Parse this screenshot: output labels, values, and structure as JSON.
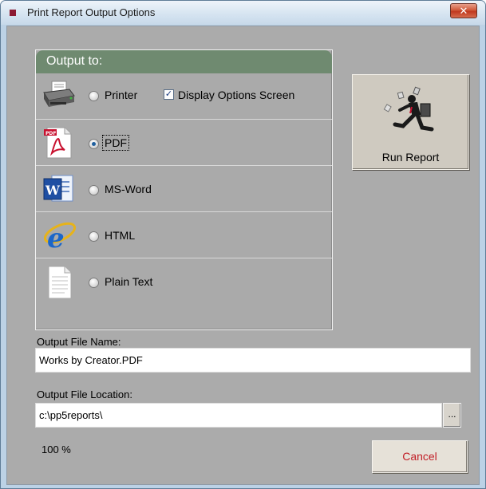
{
  "window": {
    "title": "Print Report Output Options",
    "close_label": "✕",
    "accent": "#8c1a32"
  },
  "output_group": {
    "title": "Output to:",
    "options": [
      {
        "label": "Printer",
        "icon": "printer-icon",
        "selected": false
      },
      {
        "label": "PDF",
        "icon": "pdf-document-icon",
        "selected": true
      },
      {
        "label": "MS-Word",
        "icon": "ms-word-icon",
        "selected": false
      },
      {
        "label": "HTML",
        "icon": "internet-explorer-icon",
        "selected": false
      },
      {
        "label": "Plain Text",
        "icon": "text-document-icon",
        "selected": false
      }
    ],
    "display_options": {
      "label": "Display Options Screen",
      "checked": true
    }
  },
  "run_button": {
    "label": "Run Report",
    "icon": "running-man-icon"
  },
  "file_name": {
    "label": "Output File Name:",
    "value": "Works by Creator.PDF"
  },
  "file_location": {
    "label": "Output File Location:",
    "value": "c:\\pp5reports\\",
    "browse_label": "..."
  },
  "progress": {
    "text": "100 %",
    "value": 100
  },
  "cancel_button": {
    "label": "Cancel",
    "color": "#c22028"
  }
}
